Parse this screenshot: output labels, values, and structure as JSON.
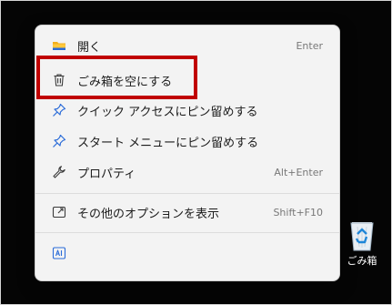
{
  "context_menu": {
    "items": [
      {
        "label": "開く",
        "shortcut": "Enter",
        "icon": "folder-icon"
      },
      {
        "label": "ごみ箱を空にする",
        "shortcut": "",
        "icon": "trash-icon"
      },
      {
        "label": "クイック アクセスにピン留めする",
        "shortcut": "",
        "icon": "pin-icon"
      },
      {
        "label": "スタート メニューにピン留めする",
        "shortcut": "",
        "icon": "pin-icon"
      },
      {
        "label": "プロパティ",
        "shortcut": "Alt+Enter",
        "icon": "wrench-icon"
      },
      {
        "label": "その他のオプションを表示",
        "shortcut": "Shift+F10",
        "icon": "share-icon"
      }
    ],
    "bottom_icon": "immersive-reader-icon"
  },
  "desktop": {
    "recycle_bin_label": "ごみ箱"
  },
  "colors": {
    "highlight": "#c00000",
    "accent": "#2b6cd8",
    "menu_bg": "#f3f3f3",
    "desktop_bg": "#050505"
  }
}
